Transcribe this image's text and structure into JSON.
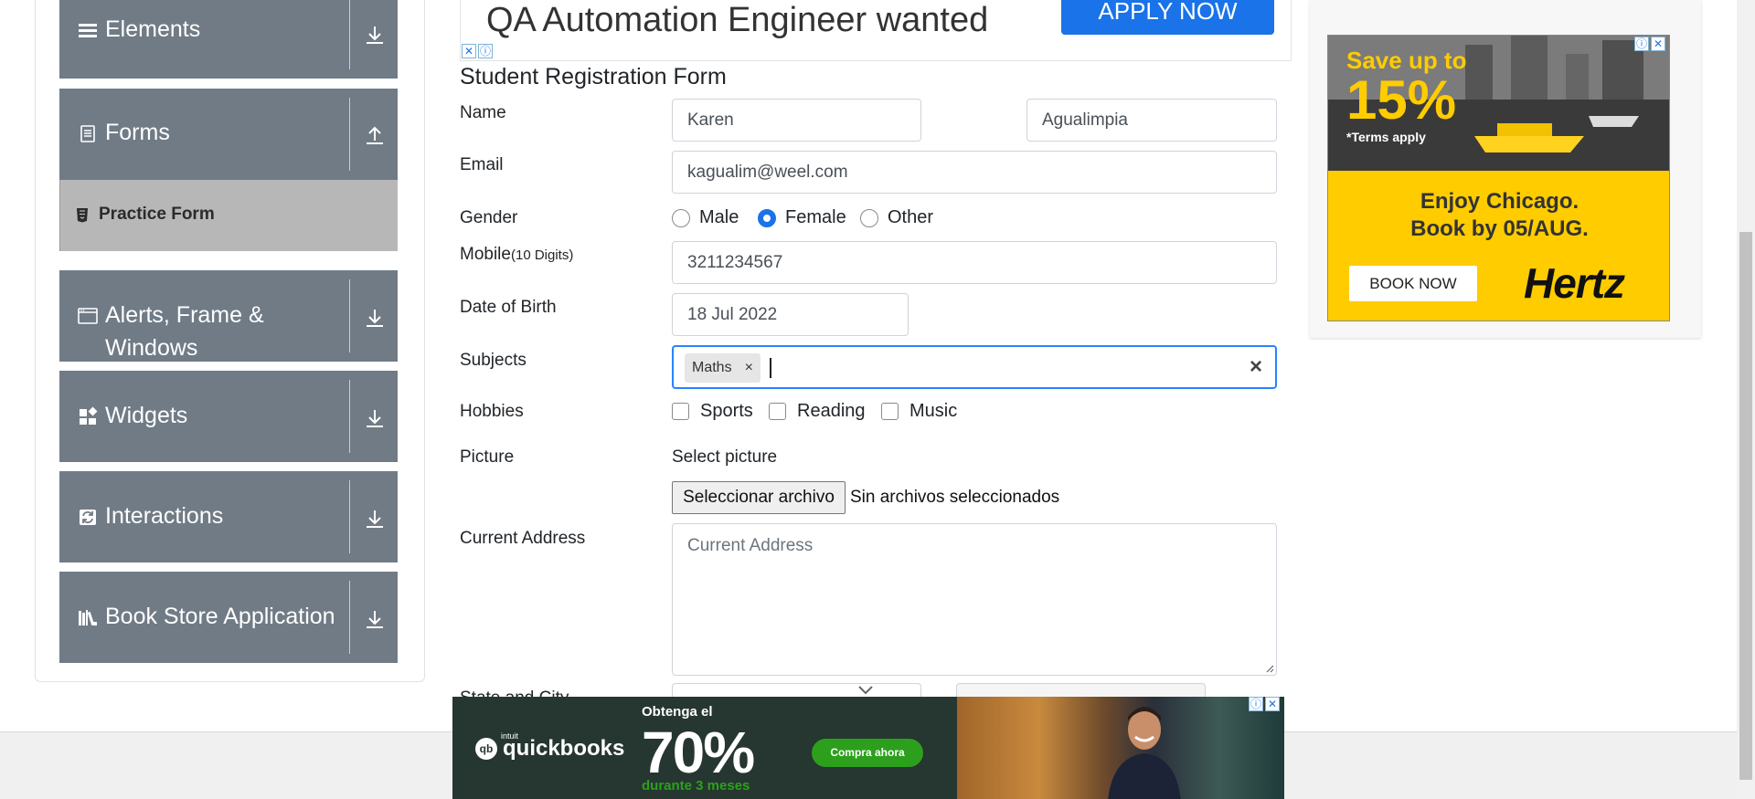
{
  "sidebar": {
    "groups": [
      {
        "label": "Elements",
        "icon": "hamburger-icon",
        "arrow": "download"
      },
      {
        "label": "Forms",
        "icon": "document-icon",
        "arrow": "upload"
      },
      {
        "label": "Alerts, Frame &",
        "label2": "Windows",
        "icon": "window-icon",
        "arrow": "download"
      },
      {
        "label": "Widgets",
        "icon": "widgets-icon",
        "arrow": "download"
      },
      {
        "label": "Interactions",
        "icon": "interactions-icon",
        "arrow": "download"
      },
      {
        "label": "Book Store Application",
        "icon": "books-icon",
        "arrow": "download"
      }
    ],
    "active_item": {
      "label": "Practice Form",
      "icon": "html5-icon"
    }
  },
  "top_ad": {
    "text": "QA Automation Engineer wanted",
    "button": "APPLY NOW"
  },
  "form": {
    "title": "Student Registration Form",
    "name_label": "Name",
    "first_name": "Karen",
    "last_name": "Agualimpia",
    "email_label": "Email",
    "email": "kagualim@weel.com",
    "gender_label": "Gender",
    "gender_options": [
      "Male",
      "Female",
      "Other"
    ],
    "gender_selected": "Female",
    "mobile_label": "Mobile",
    "mobile_hint": "(10 Digits)",
    "mobile": "3211234567",
    "dob_label": "Date of Birth",
    "dob": "18 Jul 2022",
    "subjects_label": "Subjects",
    "subjects": [
      "Maths"
    ],
    "subject_remove": "×",
    "subjects_clear": "×",
    "hobbies_label": "Hobbies",
    "hobbies": [
      "Sports",
      "Reading",
      "Music"
    ],
    "picture_label": "Picture",
    "picture_select": "Select picture",
    "file_button": "Seleccionar archivo",
    "file_status": "Sin archivos seleccionados",
    "address_label": "Current Address",
    "address_placeholder": "Current Address",
    "state_city_label": "State and City"
  },
  "bottom_ad": {
    "brand": "quickbooks",
    "brand_prefix": "intuit",
    "headline": "Obtenga el",
    "percent": "70%",
    "duration": "durante 3 meses",
    "cta": "Compra ahora"
  },
  "right_ad": {
    "save": "Save up to",
    "percent": "15%",
    "terms": "*Terms apply",
    "line1": "Enjoy Chicago.",
    "line2": "Book by 05/AUG.",
    "button": "BOOK NOW",
    "brand": "Hertz"
  },
  "colors": {
    "sidebar_group": "#707b86",
    "active_item": "#b7b7b7",
    "accent": "#1a73e8",
    "focus": "#2684ff",
    "qb_green": "#2ca01c",
    "hertz_yellow": "#ffcc00"
  }
}
